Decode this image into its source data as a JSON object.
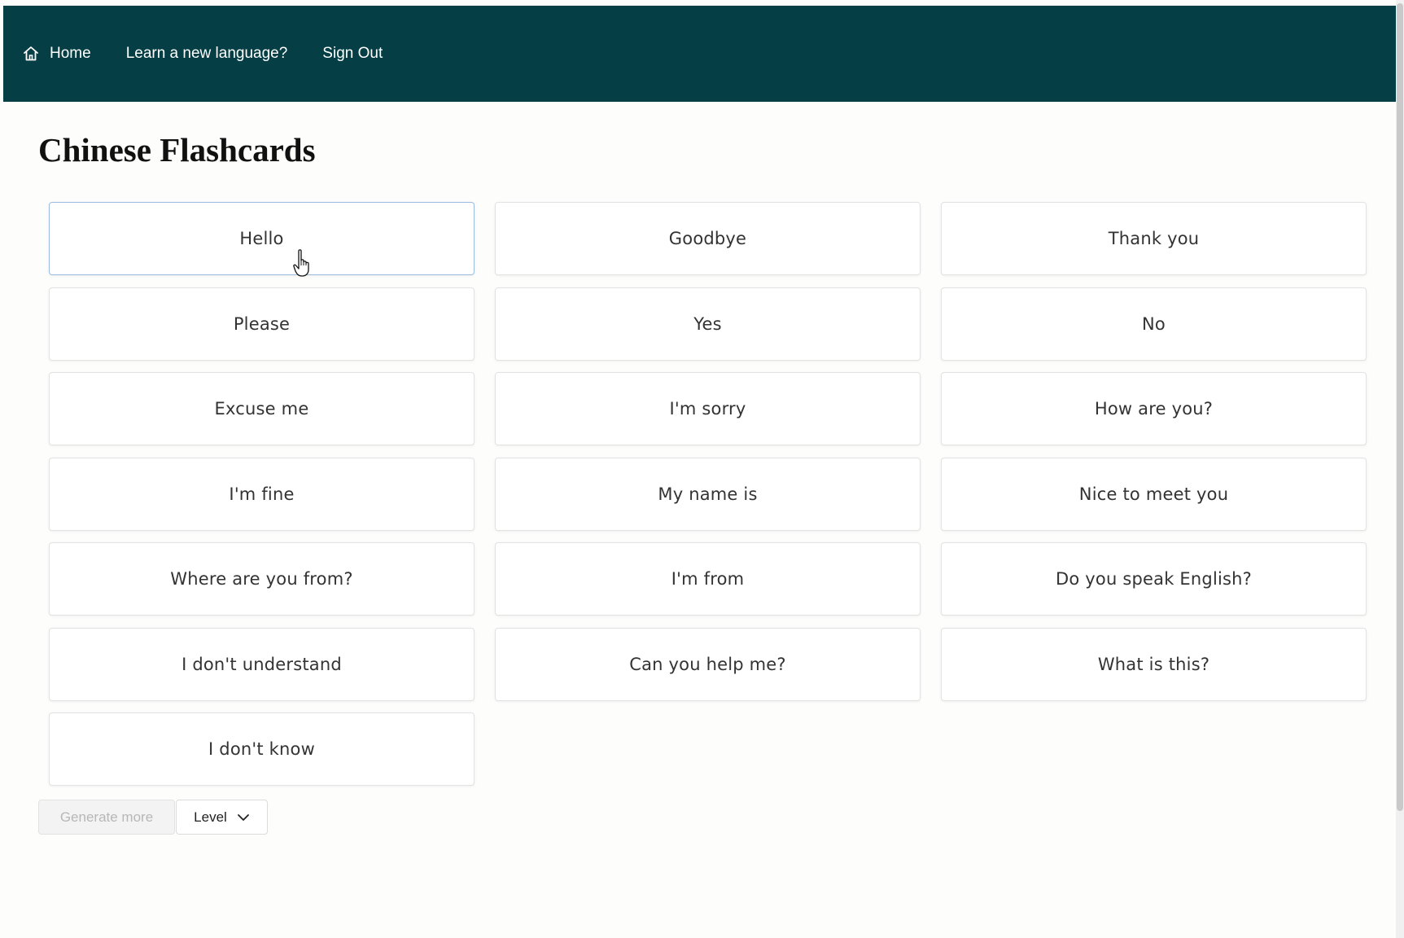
{
  "nav": {
    "home_label": "Home",
    "learn_label": "Learn a new language?",
    "signout_label": "Sign Out",
    "home_icon": "home-icon"
  },
  "page": {
    "title": "Chinese Flashcards"
  },
  "cards": [
    "Hello",
    "Goodbye",
    "Thank you",
    "Please",
    "Yes",
    "No",
    "Excuse me",
    "I'm sorry",
    "How are you?",
    "I'm fine",
    "My name is",
    "Nice to meet you",
    "Where are you from?",
    "I'm from",
    "Do you speak English?",
    "I don't understand",
    "Can you help me?",
    "What is this?",
    "I don't know"
  ],
  "controls": {
    "generate_label": "Generate more",
    "level_label": "Level",
    "level_icon": "chevron-down-icon"
  },
  "colors": {
    "header_bg": "#053f45",
    "active_card_border": "#9bbbe0"
  }
}
